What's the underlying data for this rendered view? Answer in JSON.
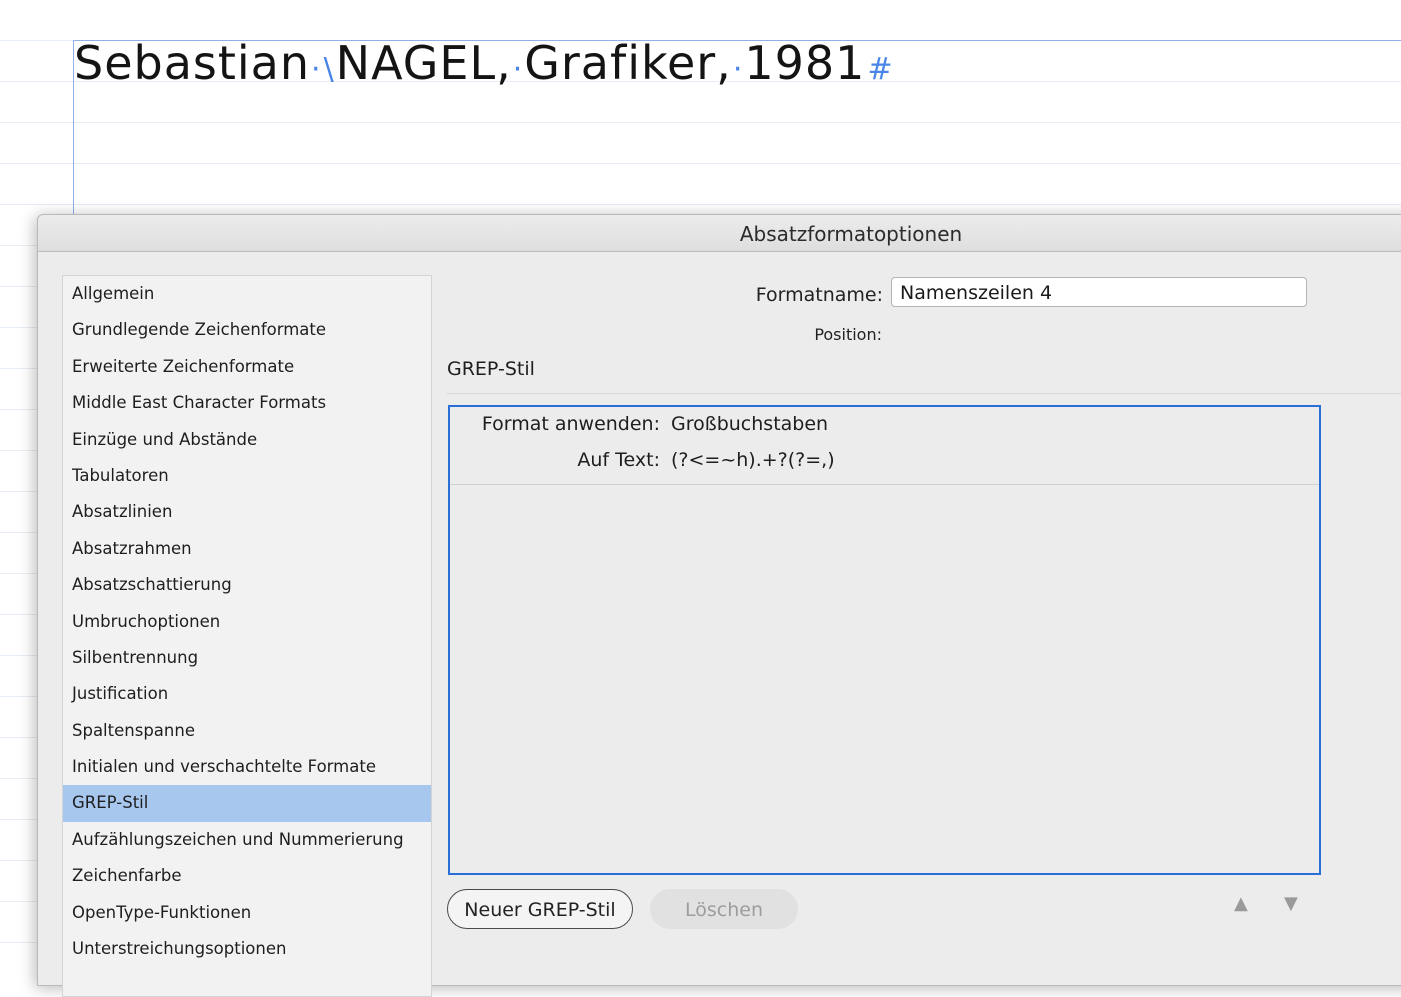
{
  "document": {
    "word1": "Sebastian",
    "word2": "NAGEL,",
    "word3": "Grafiker,",
    "word4": "1981",
    "hidden_space": "·",
    "hidden_tab": "\\",
    "para_mark": "#"
  },
  "dialog": {
    "title": "Absatzformatoptionen",
    "sidebar": {
      "items": [
        {
          "label": "Allgemein"
        },
        {
          "label": "Grundlegende Zeichenformate"
        },
        {
          "label": "Erweiterte Zeichenformate"
        },
        {
          "label": "Middle East Character Formats"
        },
        {
          "label": "Einzüge und Abstände"
        },
        {
          "label": "Tabulatoren"
        },
        {
          "label": "Absatzlinien"
        },
        {
          "label": "Absatzrahmen"
        },
        {
          "label": "Absatzschattierung"
        },
        {
          "label": "Umbruchoptionen"
        },
        {
          "label": "Silbentrennung"
        },
        {
          "label": "Justification"
        },
        {
          "label": "Spaltenspanne"
        },
        {
          "label": "Initialen und verschachtelte Formate"
        },
        {
          "label": "GREP-Stil"
        },
        {
          "label": "Aufzählungszeichen und Nummerierung"
        },
        {
          "label": "Zeichenfarbe"
        },
        {
          "label": "OpenType-Funktionen"
        },
        {
          "label": "Unterstreichungsoptionen"
        }
      ],
      "selected_label": "GREP-Stil"
    },
    "format_name_label": "Formatname:",
    "format_name_value": "Namenszeilen 4",
    "position_label": "Position:",
    "section_title": "GREP-Stil",
    "grep_styles": [
      {
        "apply_label": "Format anwenden:",
        "apply_value": "Großbuchstaben",
        "text_label": "Auf Text:",
        "text_value": "(?<=~h).+?(?=,)"
      }
    ],
    "buttons": {
      "new_grep": "Neuer GREP-Stil",
      "delete": "Löschen"
    },
    "arrows": {
      "up": "▲",
      "down": "▼"
    }
  },
  "colors": {
    "selection": "#a8c7ef",
    "focus_border": "#2a6ed8",
    "hidden_chars": "#4a86e8"
  }
}
